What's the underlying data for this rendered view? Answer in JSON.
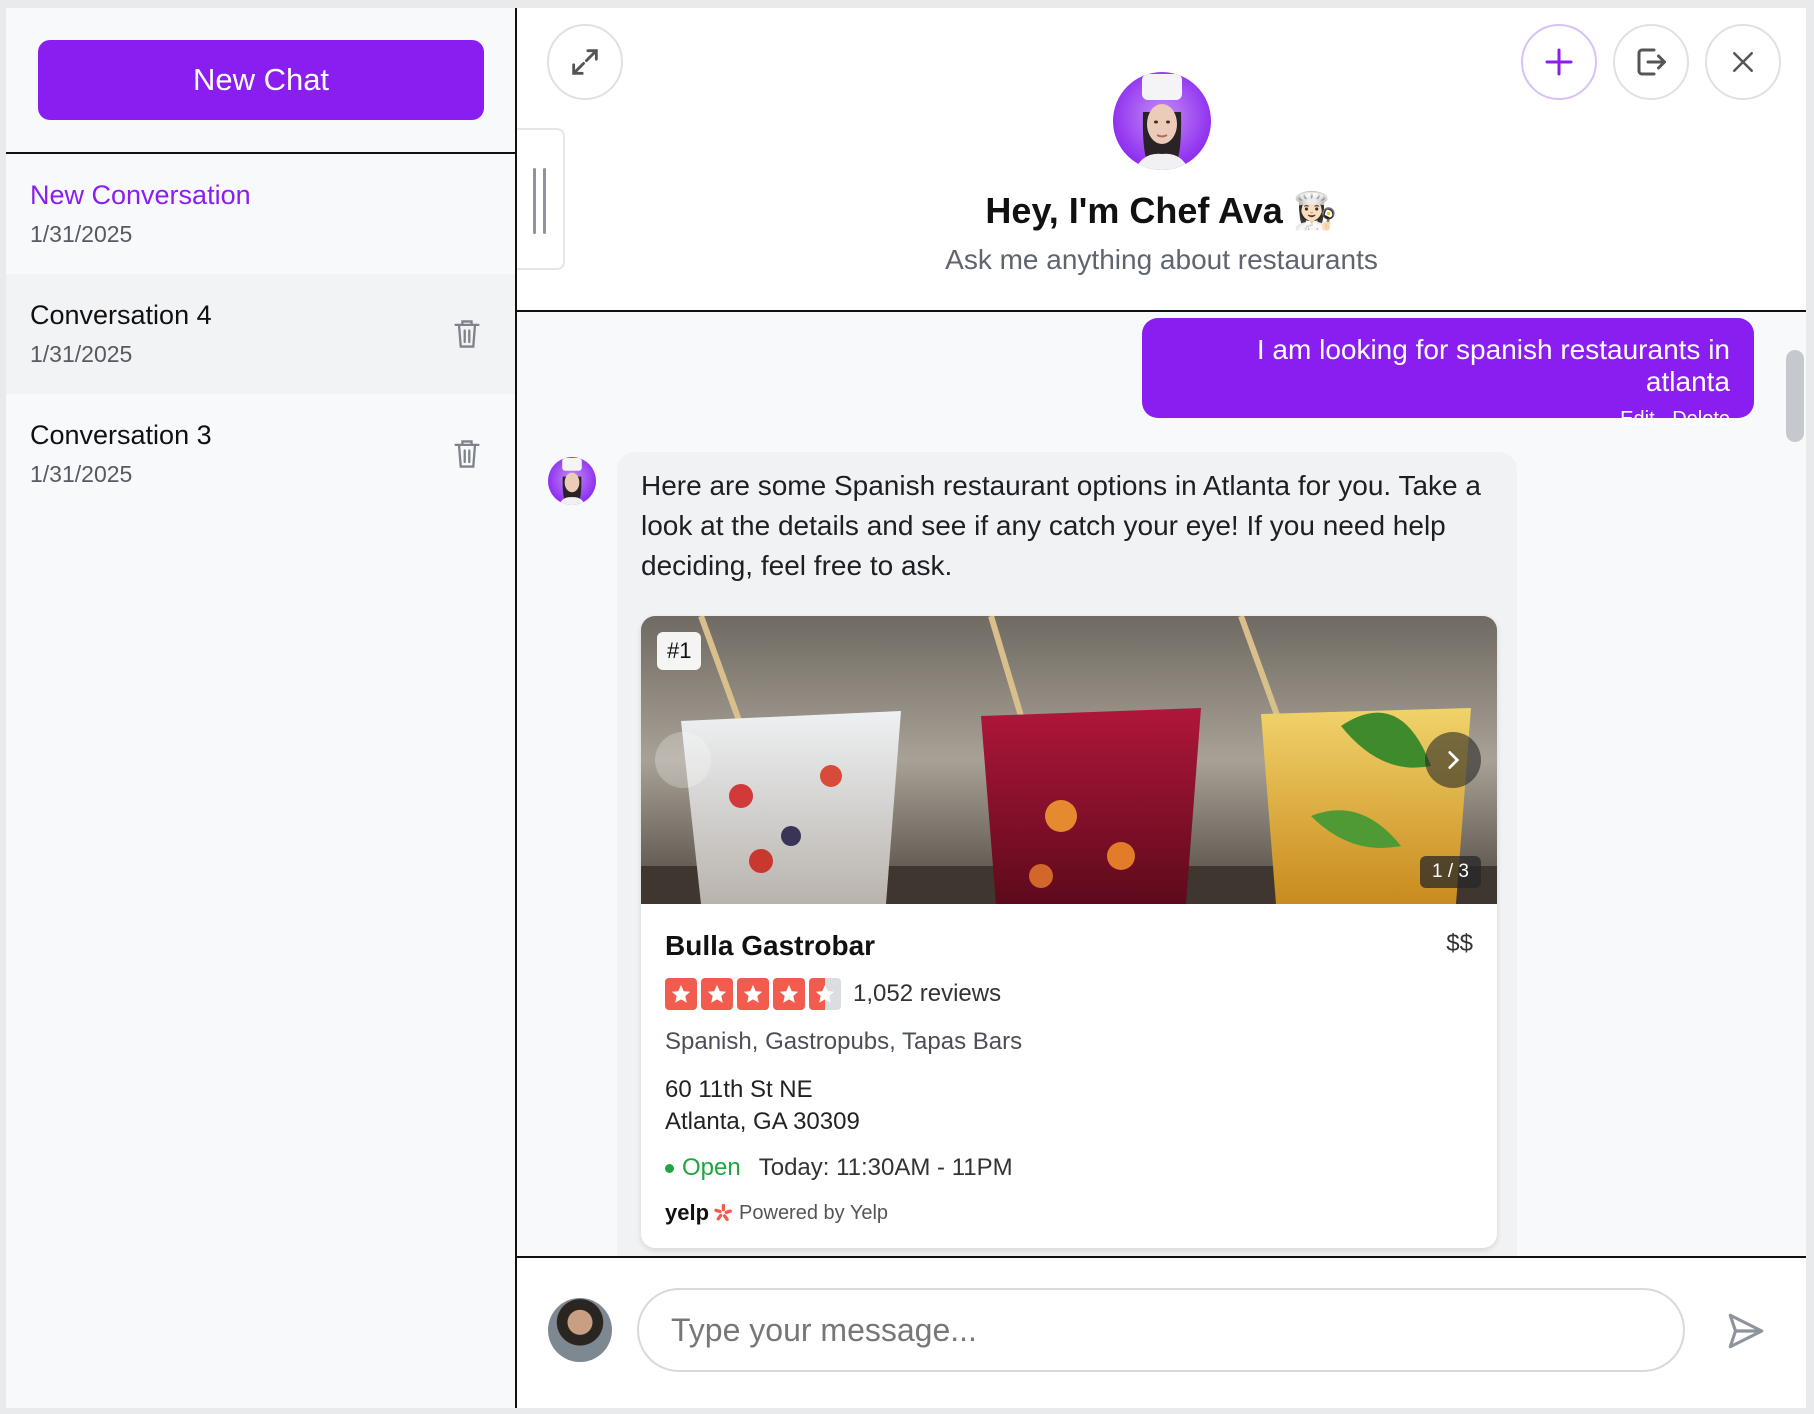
{
  "sidebar": {
    "new_chat_label": "New Chat",
    "conversations": [
      {
        "title": "New Conversation",
        "date": "1/31/2025"
      },
      {
        "title": "Conversation 4",
        "date": "1/31/2025"
      },
      {
        "title": "Conversation 3",
        "date": "1/31/2025"
      }
    ]
  },
  "header": {
    "title": "Hey, I'm Chef Ava 👩🏻‍🍳",
    "subtitle": "Ask me anything about restaurants"
  },
  "messages": {
    "user": {
      "text": "I am looking for spanish restaurants in atlanta",
      "edit_label": "Edit",
      "delete_label": "Delete"
    },
    "bot": {
      "text": "Here are some Spanish restaurant options in Atlanta for you. Take a look at the details and see if any catch your eye! If you need help deciding, feel free to ask."
    }
  },
  "card": {
    "rank": "#1",
    "image_counter": "1 / 3",
    "name": "Bulla Gastrobar",
    "price": "$$",
    "rating": 4.5,
    "reviews": "1,052 reviews",
    "categories": "Spanish, Gastropubs, Tapas Bars",
    "address_line1": "60 11th St NE",
    "address_line2": "Atlanta, GA 30309",
    "status": "Open",
    "hours": "Today: 11:30AM - 11PM",
    "yelp_logo": "yelp",
    "powered_by": "Powered by Yelp"
  },
  "input": {
    "placeholder": "Type your message..."
  },
  "colors": {
    "accent": "#8a1ef0",
    "star": "#f15c4f",
    "open": "#1fa63f"
  },
  "icons": [
    "expand-icon",
    "plus-icon",
    "logout-icon",
    "close-icon",
    "trash-icon",
    "chevron-right-icon",
    "send-icon",
    "star-icon",
    "yelp-burst-icon"
  ]
}
